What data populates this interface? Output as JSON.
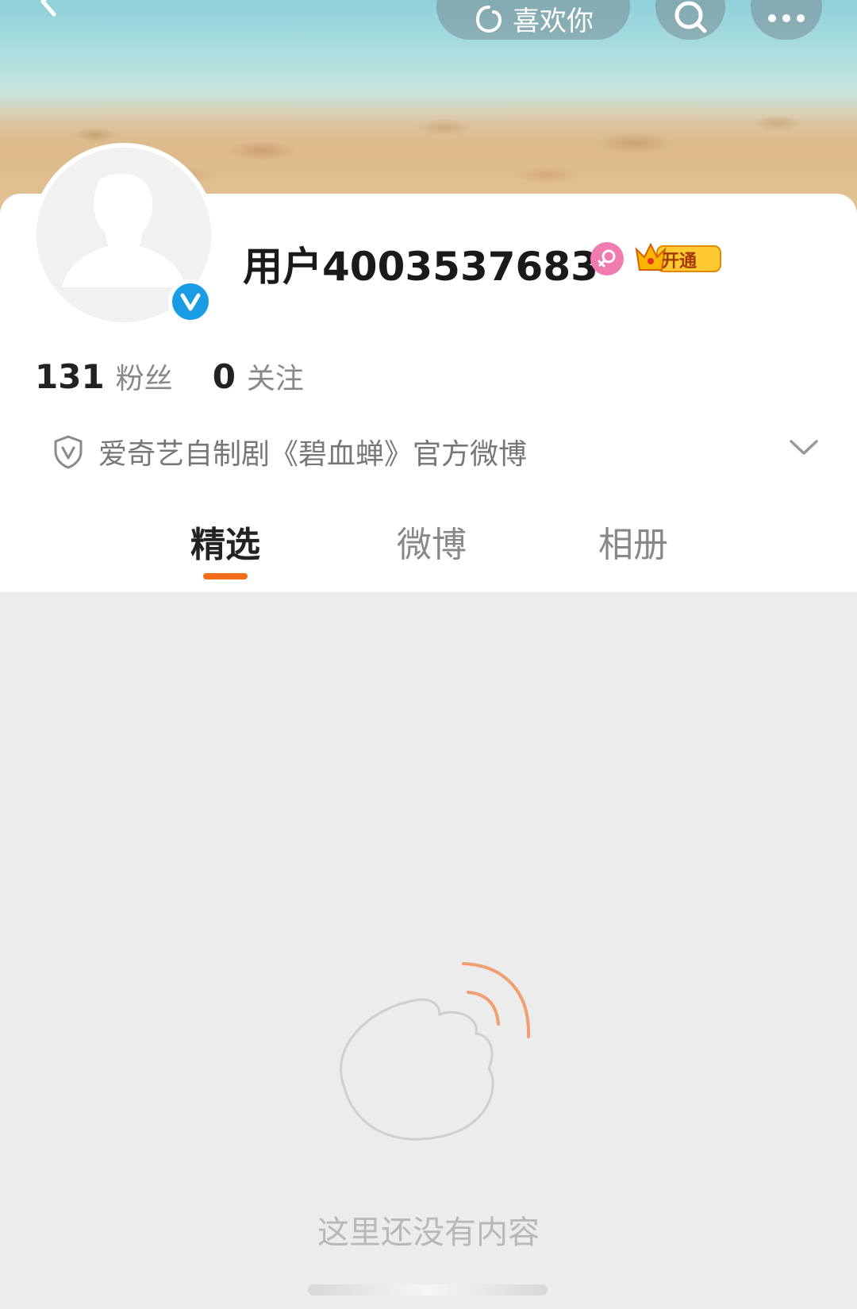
{
  "header": {
    "like_label": "喜欢你",
    "icons": [
      "back-icon",
      "like-icon",
      "search-icon",
      "more-icon"
    ]
  },
  "profile": {
    "username": "用户4003537683",
    "vip_label": "开通",
    "followers_count": "131",
    "followers_label": "粉丝",
    "following_count": "0",
    "following_label": "关注",
    "description": "爱奇艺自制剧《碧血蝉》官方微博"
  },
  "tabs": [
    {
      "label": "精选",
      "active": true
    },
    {
      "label": "微博",
      "active": false
    },
    {
      "label": "相册",
      "active": false
    }
  ],
  "empty_state": {
    "message": "这里还没有内容"
  },
  "colors": {
    "accent": "#f26c1c",
    "verified_blue": "#1a9be6",
    "gender_pink": "#f07bb0"
  }
}
